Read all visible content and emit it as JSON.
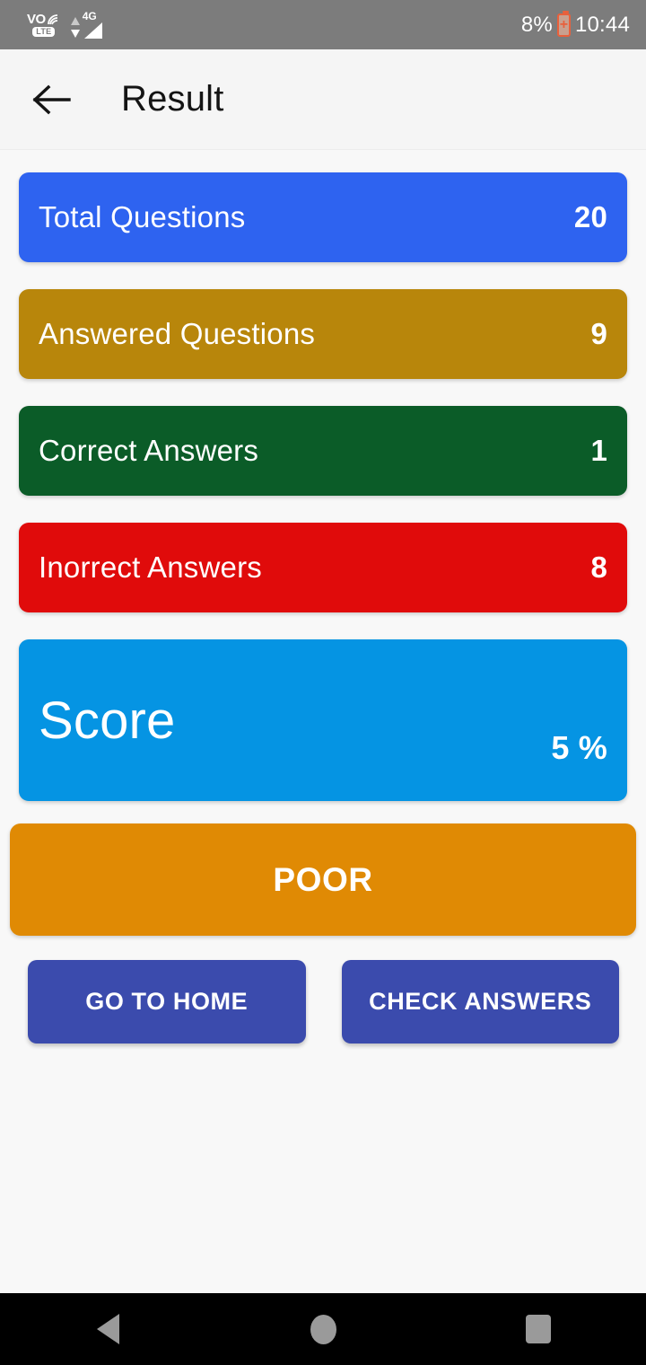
{
  "statusbar": {
    "volte_primary": "VO",
    "volte_secondary": "LTE",
    "network_label": "4G",
    "battery_percent": "8%",
    "clock": "10:44"
  },
  "appbar": {
    "back_icon": "arrow-left-icon",
    "title": "Result"
  },
  "result": {
    "cards": [
      {
        "label": "Total Questions",
        "value": "20",
        "color": "#2E63F0"
      },
      {
        "label": "Answered Questions",
        "value": "9",
        "color": "#B8860B"
      },
      {
        "label": "Correct Answers",
        "value": "1",
        "color": "#0B5C28"
      },
      {
        "label": "Inorrect Answers",
        "value": "8",
        "color": "#E00B0B"
      }
    ],
    "score": {
      "label": "Score",
      "value": "5 %",
      "color": "#0594E3"
    },
    "grade": {
      "text": "POOR",
      "color": "#E08A04"
    },
    "buttons": [
      {
        "label": "GO TO HOME",
        "color": "#3B4BAD"
      },
      {
        "label": "CHECK ANSWERS",
        "color": "#3B4BAD"
      }
    ]
  },
  "navbar": {
    "back": "nav-back-icon",
    "home": "nav-home-icon",
    "recents": "nav-recents-icon"
  }
}
